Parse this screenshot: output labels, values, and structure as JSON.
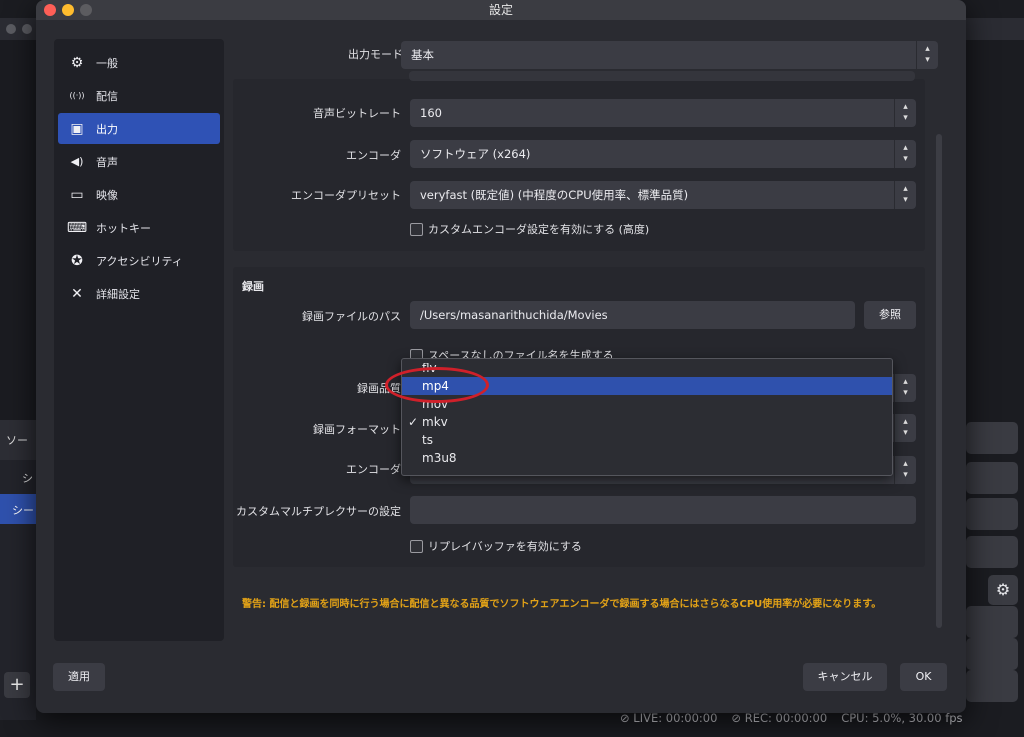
{
  "window": {
    "title": "設定"
  },
  "sidebar": {
    "items": [
      {
        "label": "一般",
        "icon": "gear-icon",
        "glyph": "⚙"
      },
      {
        "label": "配信",
        "icon": "broadcast-icon",
        "glyph": "((·))"
      },
      {
        "label": "出力",
        "icon": "output-icon",
        "glyph": "▣"
      },
      {
        "label": "音声",
        "icon": "speaker-icon",
        "glyph": "◀)"
      },
      {
        "label": "映像",
        "icon": "monitor-icon",
        "glyph": "▭"
      },
      {
        "label": "ホットキー",
        "icon": "keyboard-icon",
        "glyph": "⌨"
      },
      {
        "label": "アクセシビリティ",
        "icon": "accessibility-icon",
        "glyph": "✪"
      },
      {
        "label": "詳細設定",
        "icon": "tools-icon",
        "glyph": "✕"
      }
    ],
    "active_index": 2
  },
  "output_mode": {
    "label": "出力モード",
    "value": "基本"
  },
  "streaming": {
    "audio_bitrate": {
      "label": "音声ビットレート",
      "value": "160"
    },
    "encoder": {
      "label": "エンコーダ",
      "value": "ソフトウェア (x264)"
    },
    "encoder_preset": {
      "label": "エンコーダプリセット",
      "value": "veryfast (既定値) (中程度のCPU使用率、標準品質)"
    },
    "custom_encoder": {
      "label": "カスタムエンコーダ設定を有効にする (高度)"
    }
  },
  "recording": {
    "title": "録画",
    "path": {
      "label": "録画ファイルのパス",
      "value": "/Users/masanarithuchida/Movies",
      "browse": "参照"
    },
    "no_space": {
      "label": "スペースなしのファイル名を生成する"
    },
    "quality": {
      "label": "録画品質"
    },
    "format": {
      "label": "録画フォーマット"
    },
    "encoder": {
      "label": "エンコーダ"
    },
    "muxer": {
      "label": "カスタムマルチプレクサーの設定",
      "value": ""
    },
    "replay_buffer": {
      "label": "リプレイバッファを有効にする"
    }
  },
  "format_dropdown": {
    "options": [
      "flv",
      "mp4",
      "mov",
      "mkv",
      "ts",
      "m3u8"
    ],
    "highlighted": "mp4",
    "checked": "mkv"
  },
  "warning": "警告: 配信と録画を同時に行う場合に配信と異なる品質でソフトウェアエンコーダで録画する場合にはさらなるCPU使用率が必要になります。",
  "buttons": {
    "apply": "適用",
    "cancel": "キャンセル",
    "ok": "OK"
  },
  "background": {
    "sources_label": "ソー",
    "scene_label1": "シ",
    "scene_label2": "シー",
    "live": "LIVE: 00:00:00",
    "rec": "REC: 00:00:00",
    "cpu": "CPU: 5.0%, 30.00 fps"
  },
  "colors": {
    "accent": "#2f52b5",
    "warning": "#e2a217",
    "annotation": "#d0202a"
  }
}
